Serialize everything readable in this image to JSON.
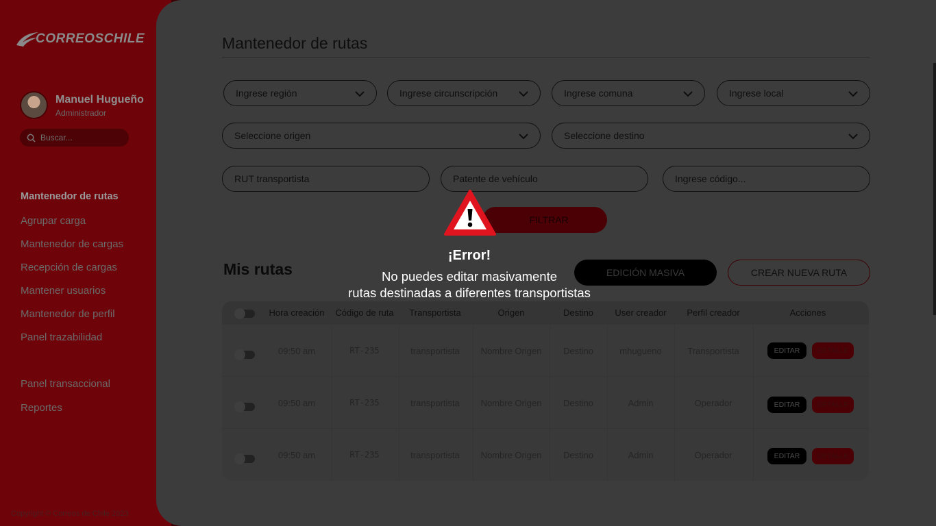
{
  "brand": {
    "logo_text": "CORREOSCHILE"
  },
  "user": {
    "name": "Manuel Hugueño",
    "role": "Administrador"
  },
  "search": {
    "placeholder": "Buscar..."
  },
  "nav": {
    "items": [
      {
        "label": "Mantenedor de rutas",
        "active": true
      },
      {
        "label": "Agrupar carga"
      },
      {
        "label": "Mantenedor de cargas"
      },
      {
        "label": "Recepción de cargas"
      },
      {
        "label": "Mantener usuarios"
      },
      {
        "label": "Mantenedor de perfil"
      },
      {
        "label": "Panel trazabilidad"
      },
      {
        "label": "Panel transaccional"
      },
      {
        "label": "Reportes"
      }
    ]
  },
  "footer": {
    "copyright": "Copyright © Correos de Chile 2023"
  },
  "page": {
    "title": "Mantenedor de rutas"
  },
  "filters": {
    "region": "Ingrese región",
    "circunscripcion": "Ingrese circunscripción",
    "comuna": "Ingrese comuna",
    "local": "Ingrese local",
    "origen": "Seleccione  origen",
    "destino": "Seleccione destino",
    "rut": "RUT transportista",
    "patente": "Patente de vehículo",
    "codigo": "Ingrese código...",
    "filter_button": "FILTRAR"
  },
  "routes": {
    "title": "Mis rutas",
    "bulk_edit_button": "EDICIÓN MASIVA",
    "new_route_button": "CREAR NUEVA RUTA",
    "columns": [
      "Hora creación",
      "Código de ruta",
      "Transportista",
      "Origen",
      "Destino",
      "User creador",
      "Perfil creador",
      "Acciones"
    ],
    "rows": [
      {
        "hora": "09:50 am",
        "codigo": "RT-235",
        "transportista": "transportista",
        "origen": "Nombre Origen",
        "destino": "Destino",
        "user": "mhugueno",
        "perfil": "Transportista"
      },
      {
        "hora": "09:50 am",
        "codigo": "RT-235",
        "transportista": "transportista",
        "origen": "Nombre Origen",
        "destino": "Destino",
        "user": "Admin",
        "perfil": "Operador"
      },
      {
        "hora": "09:50 am",
        "codigo": "RT-235",
        "transportista": "transportista",
        "origen": "Nombre Origen",
        "destino": "Destino",
        "user": "Admin",
        "perfil": "Operador"
      }
    ],
    "edit_label": "EDITAR",
    "detail_label": "DETALLE"
  },
  "error": {
    "title": "¡Error!",
    "message_line1": "No puedes editar masivamente",
    "message_line2": "rutas destinadas a diferentes transportistas"
  },
  "colors": {
    "brand_red": "#c00010",
    "overlay": "rgba(0,0,0,0.72)",
    "warning_red": "#e0141e"
  }
}
